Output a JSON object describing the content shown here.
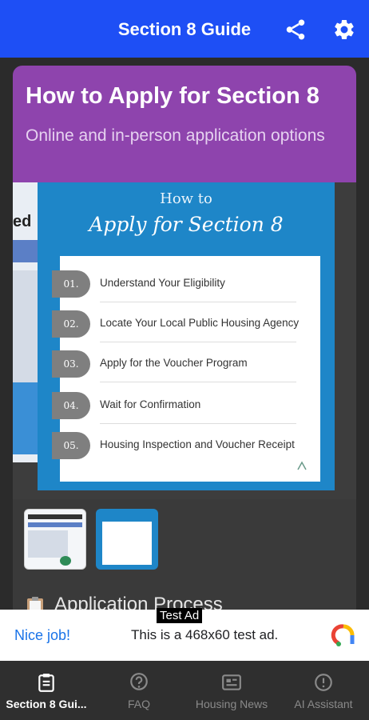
{
  "appbar": {
    "title": "Section 8 Guide",
    "share_icon": "share-icon",
    "settings_icon": "gear-icon"
  },
  "card": {
    "title": "How to Apply for Section 8",
    "subtitle": "Online and in-person application options"
  },
  "slide": {
    "how": "How to",
    "title": "Apply for Section 8",
    "steps": [
      {
        "num": "01.",
        "text": "Understand Your Eligibility"
      },
      {
        "num": "02.",
        "text": "Locate Your Local Public Housing Agency"
      },
      {
        "num": "03.",
        "text": "Apply for the Voucher Program"
      },
      {
        "num": "04.",
        "text": "Wait for Confirmation"
      },
      {
        "num": "05.",
        "text": "Housing Inspection and Voucher Receipt"
      }
    ],
    "prev_fragment": "ed"
  },
  "section": {
    "title": "Application Process",
    "icon": "clipboard-icon"
  },
  "ad": {
    "label": "Test Ad",
    "nice": "Nice job!",
    "text": "This is a 468x60 test ad."
  },
  "nav": {
    "items": [
      {
        "label": "Section 8 Gui...",
        "icon": "clipboard-icon",
        "active": true
      },
      {
        "label": "FAQ",
        "icon": "question-icon",
        "active": false
      },
      {
        "label": "Housing News",
        "icon": "newspaper-icon",
        "active": false
      },
      {
        "label": "AI Assistant",
        "icon": "info-icon",
        "active": false
      }
    ]
  },
  "colors": {
    "appbar": "#1e4ff5",
    "card_header": "#8e44ad",
    "slide_bg": "#1e86c8",
    "ad_link": "#1a73e8"
  }
}
